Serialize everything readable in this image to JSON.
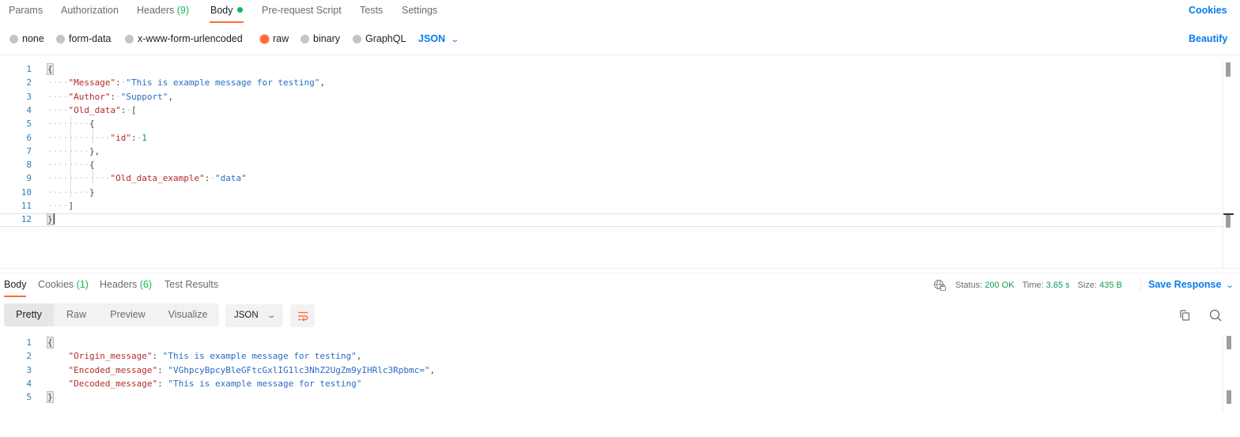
{
  "request_tabs": [
    {
      "label": "Params"
    },
    {
      "label": "Authorization"
    },
    {
      "label": "Headers",
      "count": "(9)"
    },
    {
      "label": "Body",
      "active": true,
      "indicator": "green-dot"
    },
    {
      "label": "Pre-request Script"
    },
    {
      "label": "Tests"
    },
    {
      "label": "Settings"
    }
  ],
  "cookies_link": "Cookies",
  "beautify_link": "Beautify",
  "body_types": [
    {
      "label": "none"
    },
    {
      "label": "form-data"
    },
    {
      "label": "x-www-form-urlencoded"
    },
    {
      "label": "raw",
      "checked": true
    },
    {
      "label": "binary"
    },
    {
      "label": "GraphQL"
    }
  ],
  "body_language": "JSON",
  "request_body_lines": [
    {
      "n": "1",
      "text": "{"
    },
    {
      "n": "2",
      "key": "\"Message\"",
      "value": "\"This is example message for testing\"",
      "suffix": ","
    },
    {
      "n": "3",
      "key": "\"Author\"",
      "value": "\"Support\"",
      "suffix": ","
    },
    {
      "n": "4",
      "key": "\"Old_data\"",
      "text_after": "["
    },
    {
      "n": "5",
      "text": "{"
    },
    {
      "n": "6",
      "key": "\"id\"",
      "number": "1"
    },
    {
      "n": "7",
      "text": "},"
    },
    {
      "n": "8",
      "text": "{"
    },
    {
      "n": "9",
      "key": "\"Old_data_example\"",
      "value": "\"data\""
    },
    {
      "n": "10",
      "text": "}"
    },
    {
      "n": "11",
      "text": "]"
    },
    {
      "n": "12",
      "text": "}"
    }
  ],
  "response_tabs": [
    {
      "label": "Body",
      "active": true
    },
    {
      "label": "Cookies",
      "count": "(1)"
    },
    {
      "label": "Headers",
      "count": "(6)"
    },
    {
      "label": "Test Results"
    }
  ],
  "response_status": {
    "status_label": "Status:",
    "status_value": "200 OK",
    "time_label": "Time:",
    "time_value": "3.65 s",
    "size_label": "Size:",
    "size_value": "435 B"
  },
  "save_response_label": "Save Response",
  "view_modes": [
    {
      "label": "Pretty",
      "active": true
    },
    {
      "label": "Raw"
    },
    {
      "label": "Preview"
    },
    {
      "label": "Visualize"
    }
  ],
  "response_format": "JSON",
  "response_body_lines": [
    {
      "n": "1",
      "text": "{"
    },
    {
      "n": "2",
      "key": "\"Origin_message\"",
      "value": "\"This is example message for testing\"",
      "suffix": ","
    },
    {
      "n": "3",
      "key": "\"Encoded_message\"",
      "value": "\"VGhpcyBpcyBleGFtcGxlIG1lc3NhZ2UgZm9yIHRlc3Rpbmc=\"",
      "suffix": ","
    },
    {
      "n": "4",
      "key": "\"Decoded_message\"",
      "value": "\"This is example message for testing\""
    },
    {
      "n": "5",
      "text": "}"
    }
  ],
  "colors": {
    "accent_orange": "#ff6c37",
    "link_blue": "#097bed",
    "success_green": "#0cbb52",
    "json_key": "#b52a2a",
    "json_string": "#2a6bc4"
  }
}
